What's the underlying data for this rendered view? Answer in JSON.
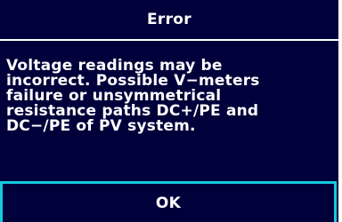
{
  "dialog": {
    "title": "Error",
    "message": "Voltage readings may be\nincorrect. Possible V−meters\nfailure or unsymmetrical\nresistance paths DC+/PE and\nDC−/PE of PV system.",
    "ok_label": "OK"
  },
  "colors": {
    "background": "#00003a",
    "text": "#ffffff",
    "button_border": "#17c9de",
    "outer": "#ffffff"
  }
}
